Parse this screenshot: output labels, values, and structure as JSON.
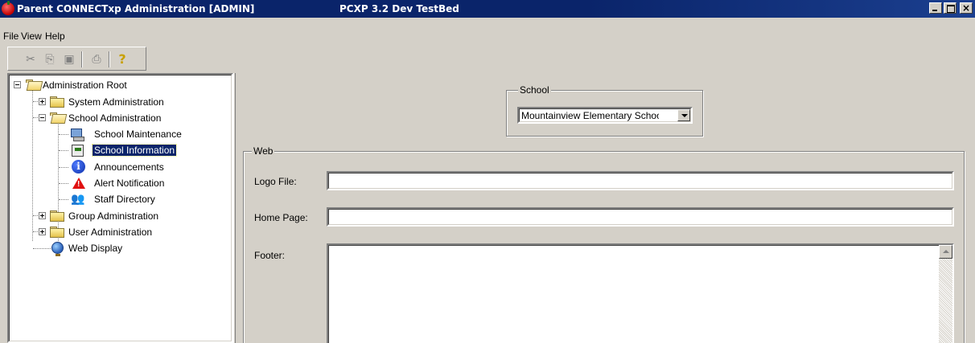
{
  "window": {
    "title": "Parent CONNECTxp Administration [ADMIN]",
    "subtitle": "PCXP 3.2 Dev TestBed",
    "close_glyph": "×"
  },
  "menu": {
    "file": "File",
    "view": "View",
    "help": "Help"
  },
  "toolbar": {
    "cut_icon": "cut-icon",
    "copy_icon": "copy-icon",
    "paste_icon": "paste-icon",
    "print_icon": "print-icon",
    "help_icon": "help-icon"
  },
  "tree": {
    "root": "Administration Root",
    "system_admin": "System Administration",
    "school_admin": "School Administration",
    "school_maintenance": "School Maintenance",
    "school_information": "School Information",
    "announcements": "Announcements",
    "alert_notification": "Alert Notification",
    "staff_directory": "Staff Directory",
    "group_admin": "Group Administration",
    "user_admin": "User Administration",
    "web_display": "Web Display",
    "selected": "School Information"
  },
  "school": {
    "legend": "School",
    "selected_value": "Mountainview Elementary School"
  },
  "web": {
    "legend": "Web",
    "logo_label": "Logo File:",
    "logo_value": "",
    "home_label": "Home Page:",
    "home_value": "",
    "footer_label": "Footer:",
    "footer_value": ""
  },
  "colors": {
    "titlebar": "#0a246a",
    "face": "#d4d0c8",
    "selection": "#0a246a"
  }
}
